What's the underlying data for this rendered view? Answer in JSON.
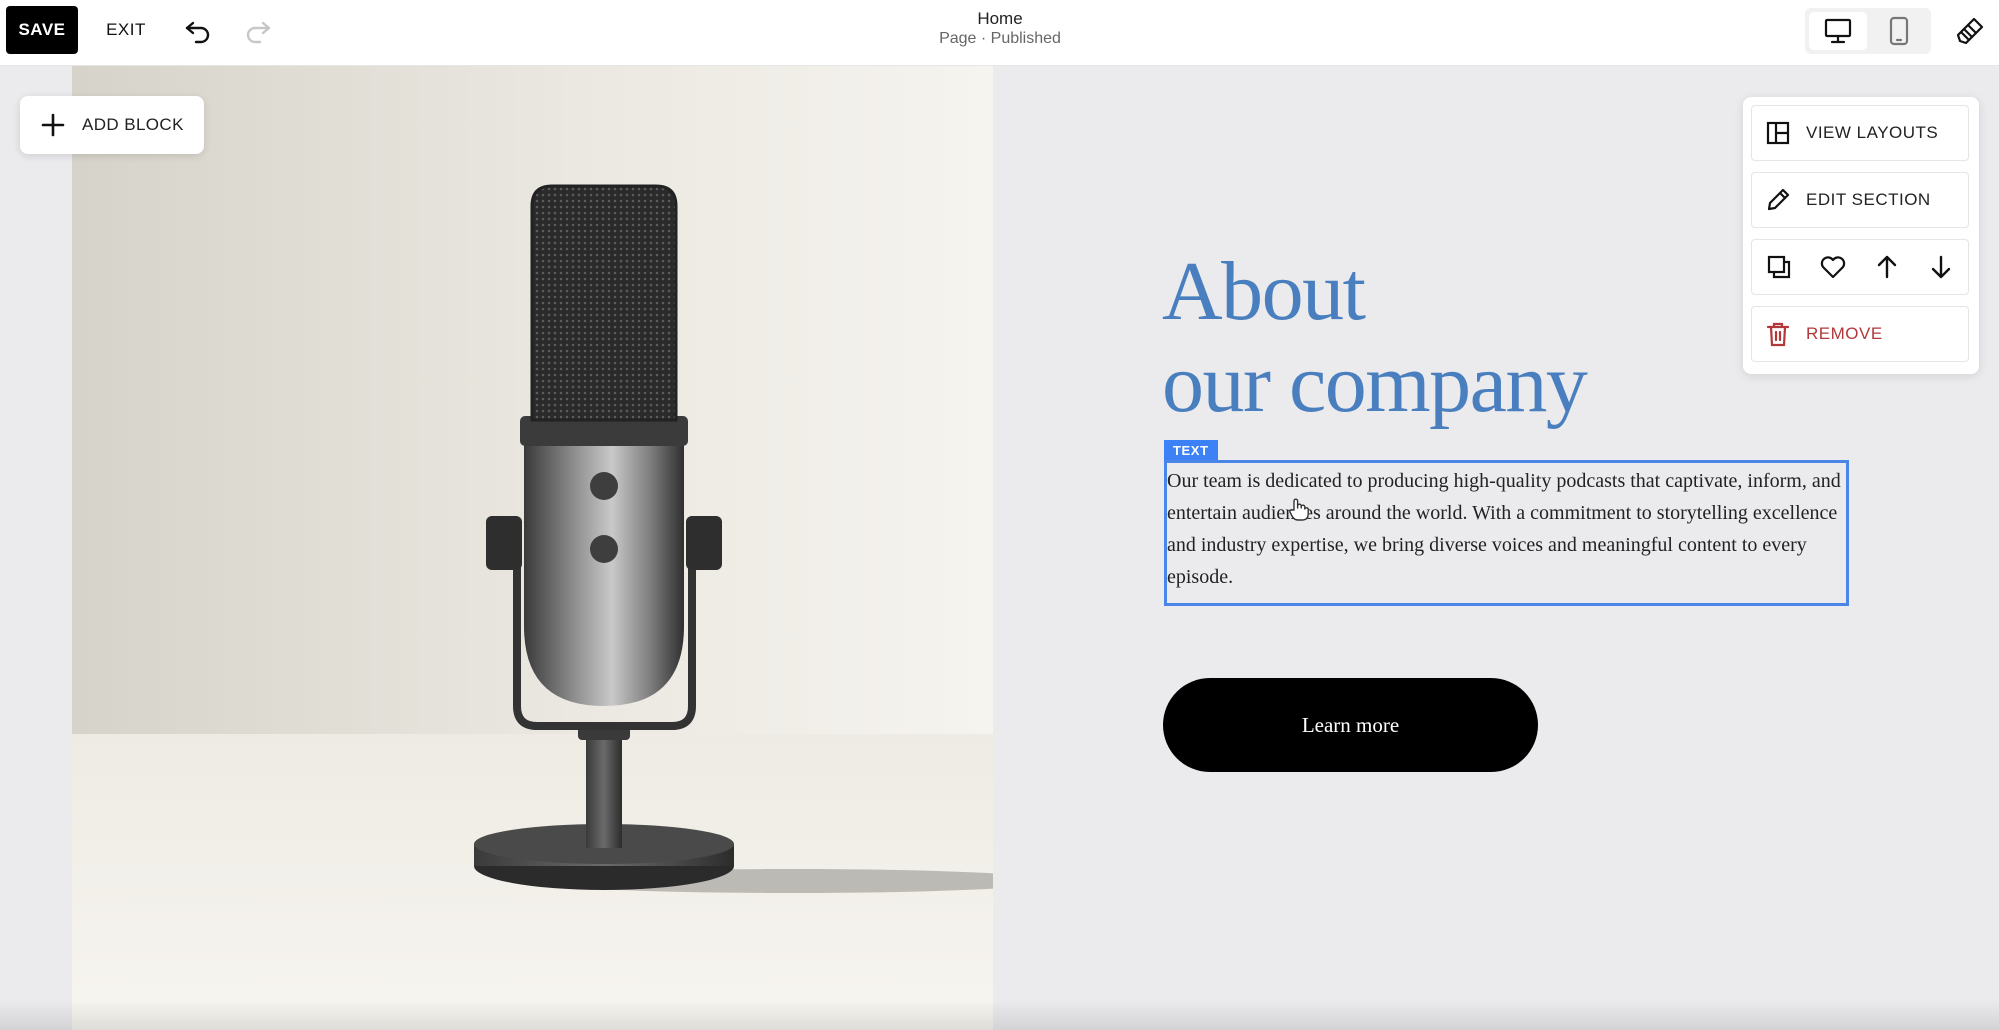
{
  "toolbar": {
    "save_label": "SAVE",
    "exit_label": "EXIT",
    "undo_icon": "undo-icon",
    "redo_icon": "redo-icon",
    "page_title": "Home",
    "page_status": "Page · Published",
    "view_modes": [
      "desktop",
      "mobile"
    ],
    "active_view": "desktop"
  },
  "editor": {
    "add_block_label": "ADD BLOCK"
  },
  "section": {
    "heading_line1": "About",
    "heading_line2": "our company",
    "text_block_tag": "TEXT",
    "body_text": "Our team is dedicated to producing high-quality podcasts that captivate, inform, and entertain audiences around the world. With a commitment to storytelling excellence and industry expertise, we bring diverse voices and meaningful content to every episode.",
    "cta_label": "Learn more"
  },
  "section_panel": {
    "view_layouts_label": "VIEW LAYOUTS",
    "edit_section_label": "EDIT SECTION",
    "remove_label": "REMOVE",
    "action_icons": [
      "duplicate-icon",
      "heart-icon",
      "arrow-up-icon",
      "arrow-down-icon"
    ]
  },
  "colors": {
    "accent_heading": "#4a7fbf",
    "selection_blue": "#4a86e8",
    "remove_red": "#b3373b",
    "canvas_bg": "#ebeaed"
  }
}
